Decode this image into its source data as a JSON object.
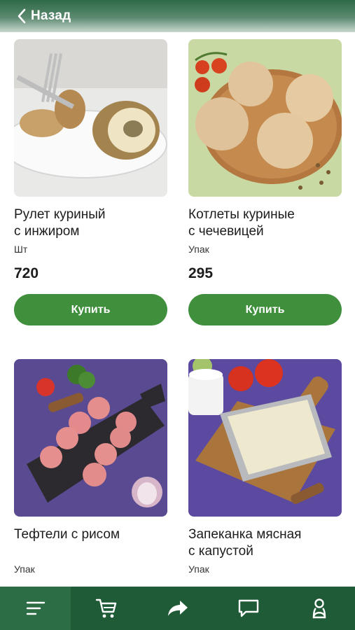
{
  "header": {
    "back_label": "Назад"
  },
  "products": [
    {
      "title": "Рулет куриный\nс инжиром",
      "unit": "Шт",
      "price": "720",
      "buy_label": "Купить"
    },
    {
      "title": "Котлеты куриные\nс чечевицей",
      "unit": "Упак",
      "price": "295",
      "buy_label": "Купить"
    },
    {
      "title": "Тефтели с рисом",
      "unit": "Упак",
      "price": "",
      "buy_label": ""
    },
    {
      "title": "Запеканка мясная\nс капустой",
      "unit": "Упак",
      "price": "",
      "buy_label": ""
    }
  ],
  "bottom_nav": {
    "items": [
      {
        "icon": "menu-icon",
        "active": true
      },
      {
        "icon": "cart-icon",
        "active": false
      },
      {
        "icon": "share-arrow-icon",
        "active": false
      },
      {
        "icon": "chat-icon",
        "active": false
      },
      {
        "icon": "profile-icon",
        "active": false
      }
    ]
  },
  "colors": {
    "brand_green": "#1f5b36",
    "button_green": "#3f8f3c",
    "text": "#1c1c1c"
  }
}
